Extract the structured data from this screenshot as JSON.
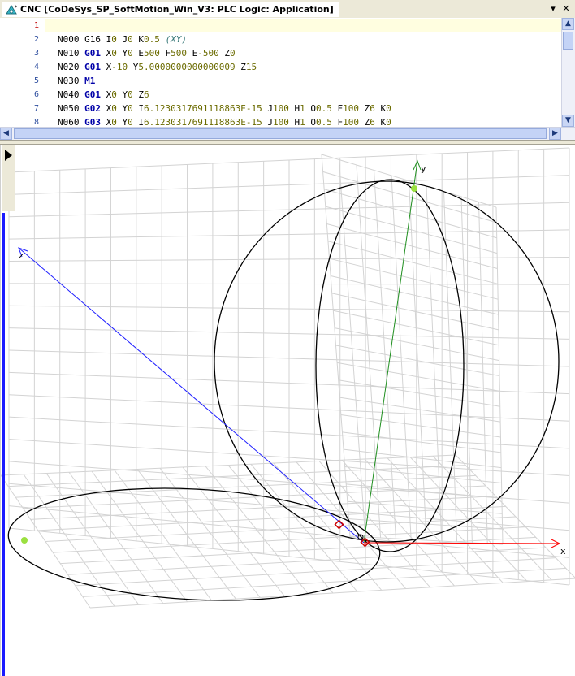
{
  "tab": {
    "title": "CNC [CoDeSys_SP_SoftMotion_Win_V3: PLC Logic: Application]"
  },
  "window_buttons": {
    "dropdown": "▾",
    "close": "✕"
  },
  "editor": {
    "lines": [
      {
        "n": "1",
        "tokens": []
      },
      {
        "n": "2",
        "tokens": [
          {
            "t": "N000 ",
            "c": "txt"
          },
          {
            "t": "G16",
            "c": "txt"
          },
          {
            "t": " I",
            "c": "txt"
          },
          {
            "t": "0",
            "c": "num"
          },
          {
            "t": " J",
            "c": "txt"
          },
          {
            "t": "0",
            "c": "num"
          },
          {
            "t": " K",
            "c": "txt"
          },
          {
            "t": "0.5",
            "c": "num"
          },
          {
            "t": " ",
            "c": "txt"
          },
          {
            "t": "(XY)",
            "c": "cm"
          }
        ]
      },
      {
        "n": "3",
        "tokens": [
          {
            "t": "N010 ",
            "c": "txt"
          },
          {
            "t": "G01",
            "c": "kw"
          },
          {
            "t": " X",
            "c": "txt"
          },
          {
            "t": "0",
            "c": "num"
          },
          {
            "t": " Y",
            "c": "txt"
          },
          {
            "t": "0",
            "c": "num"
          },
          {
            "t": " E",
            "c": "txt"
          },
          {
            "t": "500",
            "c": "num"
          },
          {
            "t": " F",
            "c": "txt"
          },
          {
            "t": "500",
            "c": "num"
          },
          {
            "t": " E",
            "c": "txt"
          },
          {
            "t": "-500",
            "c": "num"
          },
          {
            "t": " Z",
            "c": "txt"
          },
          {
            "t": "0",
            "c": "num"
          }
        ]
      },
      {
        "n": "4",
        "tokens": [
          {
            "t": "N020 ",
            "c": "txt"
          },
          {
            "t": "G01",
            "c": "kw"
          },
          {
            "t": " X",
            "c": "txt"
          },
          {
            "t": "-10",
            "c": "num"
          },
          {
            "t": " Y",
            "c": "txt"
          },
          {
            "t": "5.0000000000000009",
            "c": "num"
          },
          {
            "t": " Z",
            "c": "txt"
          },
          {
            "t": "15",
            "c": "num"
          }
        ]
      },
      {
        "n": "5",
        "tokens": [
          {
            "t": "N030 ",
            "c": "txt"
          },
          {
            "t": "M1",
            "c": "kw"
          }
        ]
      },
      {
        "n": "6",
        "tokens": [
          {
            "t": "N040 ",
            "c": "txt"
          },
          {
            "t": "G01",
            "c": "kw"
          },
          {
            "t": " X",
            "c": "txt"
          },
          {
            "t": "0",
            "c": "num"
          },
          {
            "t": " Y",
            "c": "txt"
          },
          {
            "t": "0",
            "c": "num"
          },
          {
            "t": " Z",
            "c": "txt"
          },
          {
            "t": "6",
            "c": "num"
          }
        ]
      },
      {
        "n": "7",
        "tokens": [
          {
            "t": "N050 ",
            "c": "txt"
          },
          {
            "t": "G02",
            "c": "kw"
          },
          {
            "t": " X",
            "c": "txt"
          },
          {
            "t": "0",
            "c": "num"
          },
          {
            "t": " Y",
            "c": "txt"
          },
          {
            "t": "0",
            "c": "num"
          },
          {
            "t": " I",
            "c": "txt"
          },
          {
            "t": "6.1230317691118863E-15",
            "c": "num"
          },
          {
            "t": " J",
            "c": "txt"
          },
          {
            "t": "100",
            "c": "num"
          },
          {
            "t": " H",
            "c": "txt"
          },
          {
            "t": "1",
            "c": "num"
          },
          {
            "t": " O",
            "c": "txt"
          },
          {
            "t": "0.5",
            "c": "num"
          },
          {
            "t": " F",
            "c": "txt"
          },
          {
            "t": "100",
            "c": "num"
          },
          {
            "t": " Z",
            "c": "txt"
          },
          {
            "t": "6",
            "c": "num"
          },
          {
            "t": " K",
            "c": "txt"
          },
          {
            "t": "0",
            "c": "num"
          }
        ]
      },
      {
        "n": "8",
        "tokens": [
          {
            "t": "N060 ",
            "c": "txt"
          },
          {
            "t": "G03",
            "c": "kw"
          },
          {
            "t": " X",
            "c": "txt"
          },
          {
            "t": "0",
            "c": "num"
          },
          {
            "t": " Y",
            "c": "txt"
          },
          {
            "t": "0",
            "c": "num"
          },
          {
            "t": " I",
            "c": "txt"
          },
          {
            "t": "6.1230317691118863E-15",
            "c": "num"
          },
          {
            "t": " J",
            "c": "txt"
          },
          {
            "t": "100",
            "c": "num"
          },
          {
            "t": " H",
            "c": "txt"
          },
          {
            "t": "1",
            "c": "num"
          },
          {
            "t": " O",
            "c": "txt"
          },
          {
            "t": "0.5",
            "c": "num"
          },
          {
            "t": " F",
            "c": "txt"
          },
          {
            "t": "100",
            "c": "num"
          },
          {
            "t": " Z",
            "c": "txt"
          },
          {
            "t": "6",
            "c": "num"
          },
          {
            "t": " K",
            "c": "txt"
          },
          {
            "t": "0",
            "c": "num"
          }
        ]
      }
    ]
  },
  "view3d": {
    "axis_labels": {
      "x": "x",
      "y": "y",
      "z": "z"
    },
    "colors": {
      "x_axis": "#ff0000",
      "y_axis": "#1f8f1f",
      "z_axis": "#2020ff",
      "grid": "#d3d3d3",
      "path": "#000000",
      "marker": "#cc0000",
      "point": "#9be040"
    }
  }
}
